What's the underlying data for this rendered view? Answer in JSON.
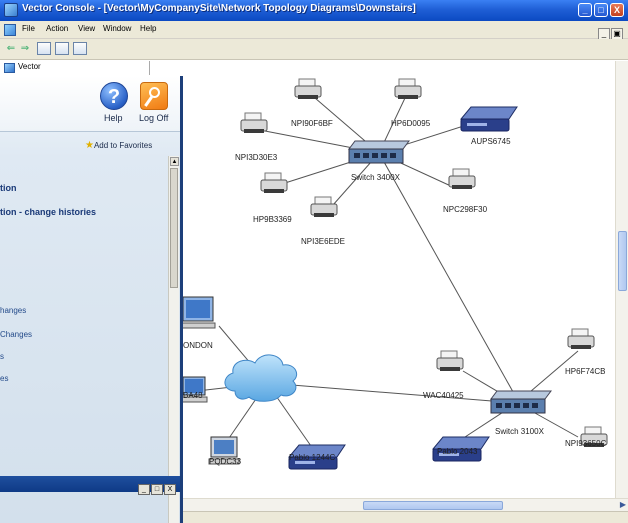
{
  "window": {
    "title": "Vector Console - [Vector\\MyCompanySite\\Network Topology Diagrams\\Downstairs]",
    "controls": [
      "_",
      "□",
      "X"
    ]
  },
  "menubar": {
    "items": [
      "File",
      "Action",
      "View",
      "Window",
      "Help"
    ],
    "mdi_controls": [
      "_",
      "▣"
    ]
  },
  "toolbar": {
    "back": "⇐",
    "forward": "⇒"
  },
  "tree": {
    "root_label": "Vector"
  },
  "help_window": {
    "help_label": "Help",
    "logoff_label": "Log Off",
    "favorites_label": "Add to Favorites",
    "links": [
      {
        "text": "tion",
        "bold": true
      },
      {
        "text": "tion - change histories",
        "bold": true
      },
      {
        "text": "hanges",
        "bold": false
      },
      {
        "text": "Changes",
        "bold": false
      },
      {
        "text": "s",
        "bold": false
      },
      {
        "text": "es",
        "bold": false
      }
    ],
    "bottom_controls": [
      "_",
      "□",
      "X"
    ]
  },
  "diagram": {
    "nodes": [
      {
        "id": "npi90f6bf",
        "type": "printer",
        "label": "NPI90F6BF"
      },
      {
        "id": "hp6d0095",
        "type": "printer",
        "label": "HP6D0095"
      },
      {
        "id": "npi3d30e3",
        "type": "printer",
        "label": "NPI3D30E3"
      },
      {
        "id": "aups6745",
        "type": "ups",
        "label": "AUPS6745"
      },
      {
        "id": "switch3400x",
        "type": "switch",
        "label": "Switch 3400X"
      },
      {
        "id": "hp9b3369",
        "type": "printer",
        "label": "HP9B3369"
      },
      {
        "id": "npc298f30",
        "type": "printer",
        "label": "NPC298F30"
      },
      {
        "id": "npi3e6ede",
        "type": "printer",
        "label": "NPI3E6EDE"
      },
      {
        "id": "london",
        "type": "computer",
        "label": "ONDON"
      },
      {
        "id": "cloud",
        "type": "cloud",
        "label": ""
      },
      {
        "id": "ba48",
        "type": "computer",
        "label": "BA48"
      },
      {
        "id": "pqdc33",
        "type": "computer",
        "label": "PQDC33"
      },
      {
        "id": "pablo1244c",
        "type": "ups",
        "label": "Pablo 1244C"
      },
      {
        "id": "wac40425",
        "type": "printer",
        "label": "WAC40425"
      },
      {
        "id": "switch3100x",
        "type": "switch",
        "label": "Switch 3100X"
      },
      {
        "id": "hp6f74cb",
        "type": "printer",
        "label": "HP6F74CB"
      },
      {
        "id": "pablo2043",
        "type": "ups",
        "label": "Pablo 2043"
      },
      {
        "id": "npi93650c",
        "type": "printer",
        "label": "NPI93650C"
      }
    ]
  },
  "colors": {
    "titlebar": "#0b49c2",
    "help_window_border": "#1d3f7a",
    "cloud": "#6fb7ea",
    "switch": "#5b7fae",
    "ups": "#2a3f8a"
  }
}
